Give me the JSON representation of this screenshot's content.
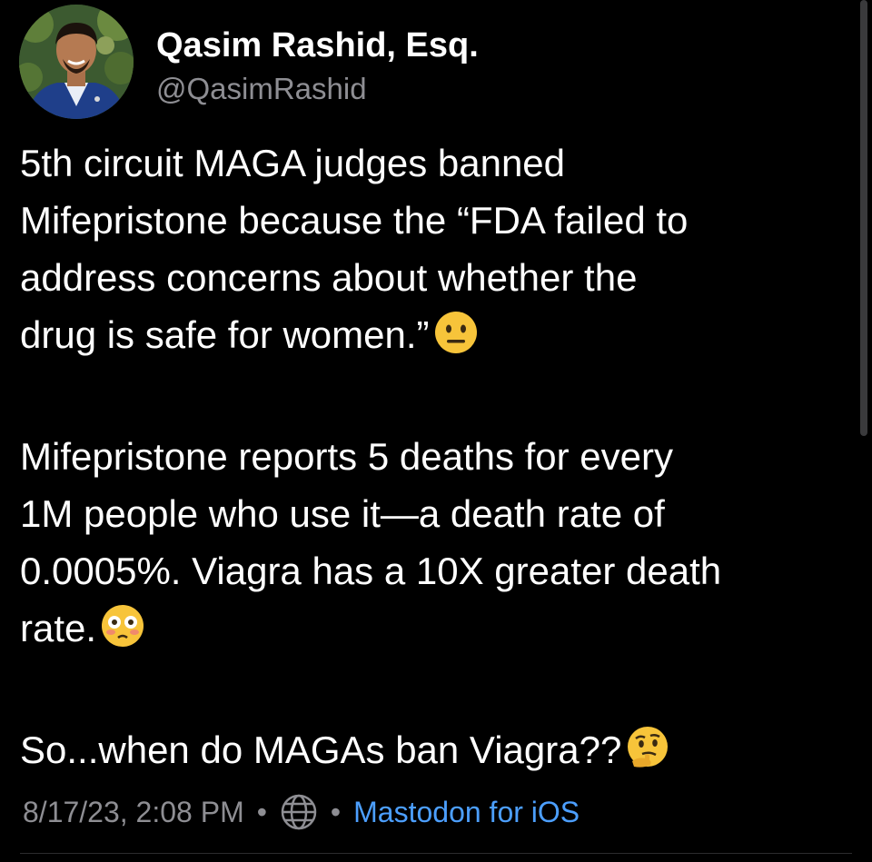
{
  "author": {
    "display_name": "Qasim Rashid, Esq.",
    "handle": "@QasimRashid",
    "avatar_icon": "profile-photo"
  },
  "post": {
    "paragraphs": [
      {
        "lines": [
          "5th circuit MAGA judges banned",
          "Mifepristone because the “FDA failed to",
          "address concerns about whether the",
          "drug is safe for women.”"
        ],
        "emoji": "😐"
      },
      {
        "lines": [
          "Mifepristone reports 5 deaths for every",
          "1M people who use it—a death rate of",
          "0.0005%. Viagra has a 10X greater death",
          "rate."
        ],
        "emoji": "😳"
      },
      {
        "lines": [
          "So...when do MAGAs ban Viagra??"
        ],
        "emoji": "🤔"
      }
    ]
  },
  "meta": {
    "timestamp": "8/17/23, 2:08 PM",
    "separator": "•",
    "visibility_icon": "globe-icon",
    "client": "Mastodon for iOS"
  },
  "colors": {
    "background": "#000000",
    "text": "#ffffff",
    "secondary_text": "#8e8e93",
    "link": "#4c9fff"
  }
}
